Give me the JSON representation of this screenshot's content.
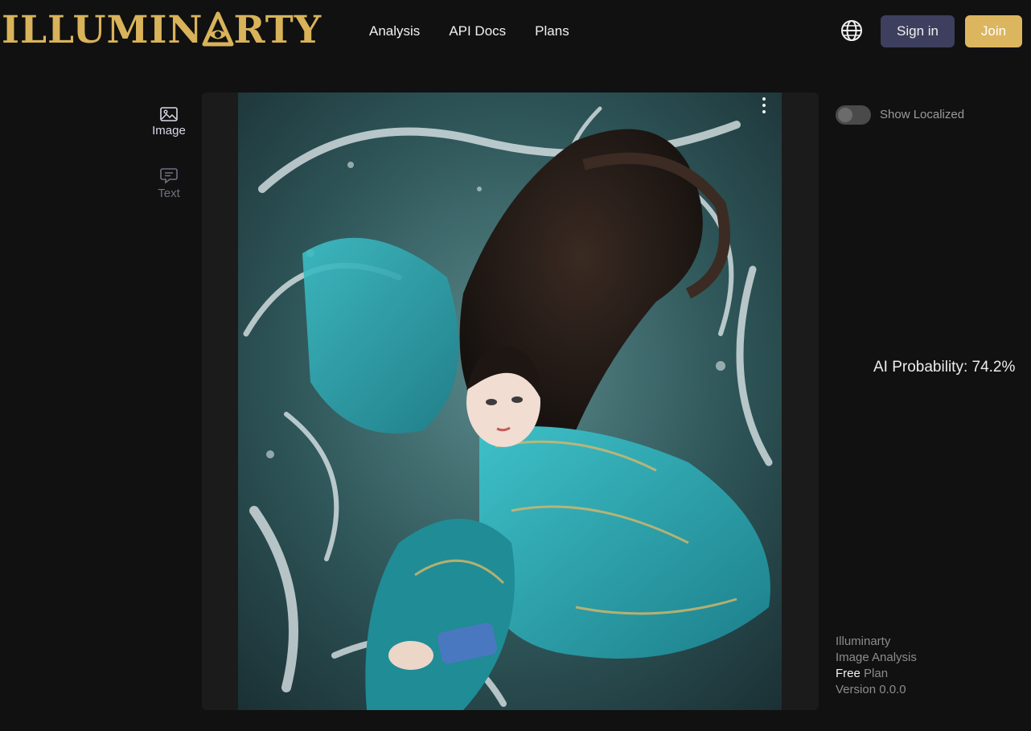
{
  "header": {
    "logo_text": "ILLUMINARTY",
    "logo_before": "ILLUMIN",
    "logo_after": "RTY",
    "nav": [
      {
        "label": "Analysis"
      },
      {
        "label": "API Docs"
      },
      {
        "label": "Plans"
      }
    ],
    "sign_in_label": "Sign in",
    "join_label": "Join",
    "icons": {
      "language": "globe-icon"
    }
  },
  "sidebar": {
    "tabs": [
      {
        "label": "Image",
        "icon": "image-icon",
        "active": true
      },
      {
        "label": "Text",
        "icon": "chat-bubble-icon",
        "active": false
      }
    ]
  },
  "analysis": {
    "toggle_label": "Show Localized",
    "toggle_on": false,
    "probability_text": "AI Probability: 74.2%",
    "probability_value": 74.2
  },
  "footer": {
    "line1": "Illuminarty",
    "line2": "Image Analysis",
    "plan_name": "Free",
    "plan_suffix": " Plan",
    "version": "Version 0.0.0"
  },
  "colors": {
    "background": "#111111",
    "brand_gold": "#d9b35a",
    "sign_in_bg": "#3e3e5e",
    "join_bg": "#dcb65e",
    "panel_bg": "#1b1b1b"
  }
}
